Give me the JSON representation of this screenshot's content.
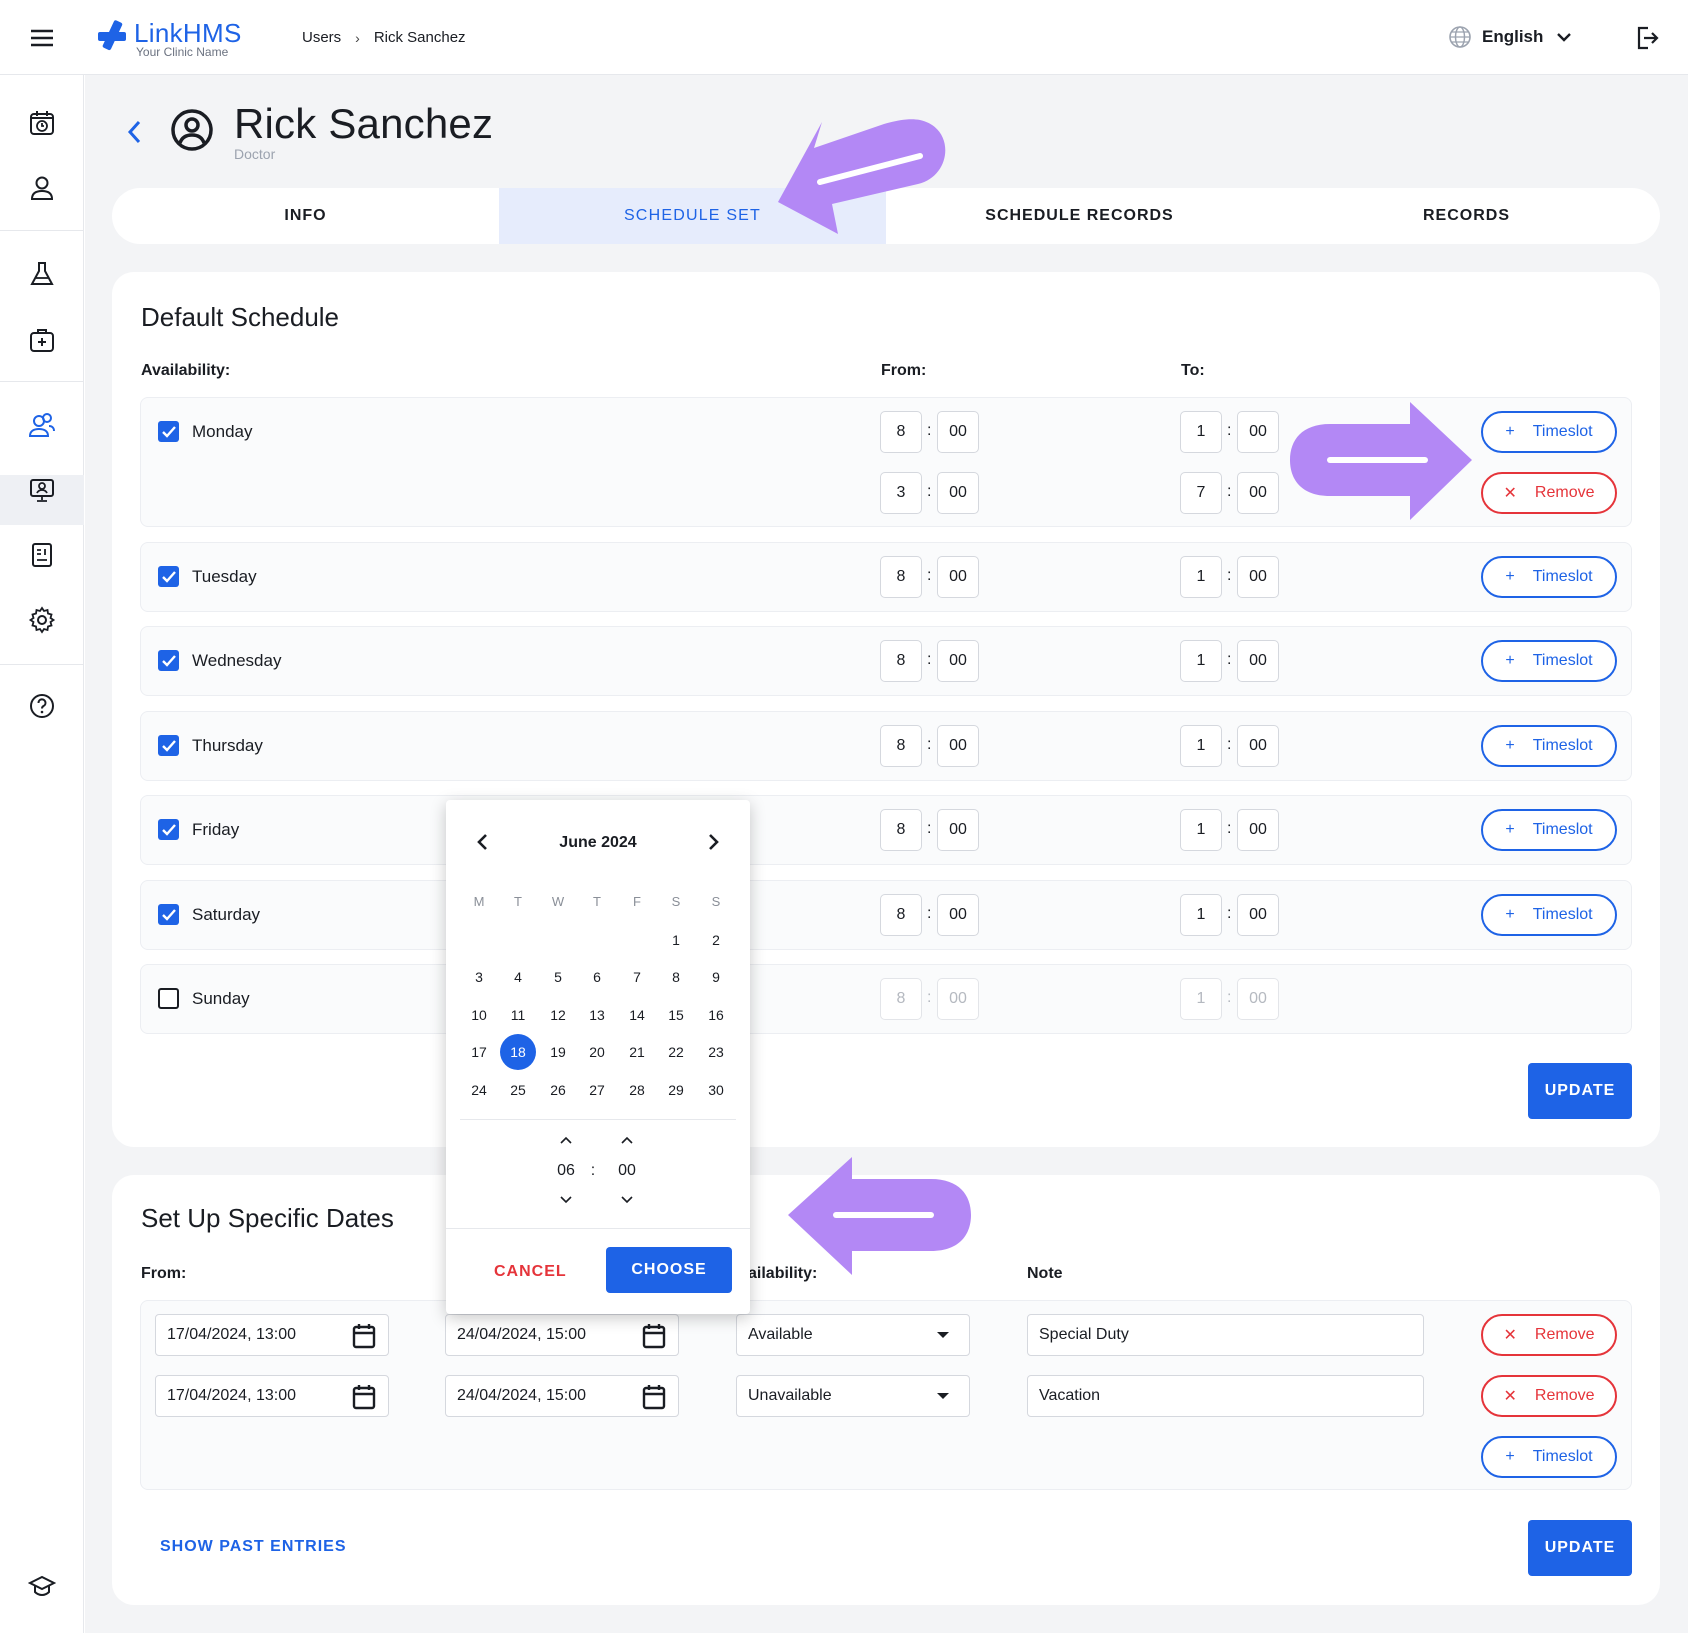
{
  "app": {
    "logo_name_link": "Link",
    "logo_name_hms": "HMS",
    "logo_sub": "Your Clinic Name",
    "brand_color": "#1e63e6"
  },
  "breadcrumb": [
    "Users",
    "Rick Sanchez"
  ],
  "language": "English",
  "sidebar_icons": [
    "calendar-clock-icon",
    "person-icon",
    "flask-icon",
    "medical-kit-icon",
    "users-icon",
    "monitor-person-icon",
    "invoice-icon",
    "gear-icon",
    "help-icon",
    "graduation-cap-icon"
  ],
  "profile": {
    "name": "Rick Sanchez",
    "role": "Doctor"
  },
  "tabs": [
    {
      "label": "INFO",
      "active": false
    },
    {
      "label": "SCHEDULE SET",
      "active": true
    },
    {
      "label": "SCHEDULE RECORDS",
      "active": false
    },
    {
      "label": "RECORDS",
      "active": false
    }
  ],
  "default_schedule": {
    "title": "Default Schedule",
    "availability_label": "Availability:",
    "from_label": "From:",
    "to_label": "To:",
    "timeslot_label": "Timeslot",
    "remove_label": "Remove",
    "update_label": "UPDATE",
    "monday": {
      "day": "Monday",
      "checked": true,
      "slots": [
        {
          "from_h": "8",
          "from_m": "00",
          "to_h": "1",
          "to_m": "00"
        },
        {
          "from_h": "3",
          "from_m": "00",
          "to_h": "7",
          "to_m": "00"
        }
      ]
    },
    "tuesday": {
      "day": "Tuesday",
      "checked": true,
      "from_h": "8",
      "from_m": "00",
      "to_h": "1",
      "to_m": "00"
    },
    "wednesday": {
      "day": "Wednesday",
      "checked": true,
      "from_h": "8",
      "from_m": "00",
      "to_h": "1",
      "to_m": "00"
    },
    "thursday": {
      "day": "Thursday",
      "checked": true,
      "from_h": "8",
      "from_m": "00",
      "to_h": "1",
      "to_m": "00"
    },
    "friday": {
      "day": "Friday",
      "checked": true,
      "from_h": "8",
      "from_m": "00",
      "to_h": "1",
      "to_m": "00"
    },
    "saturday": {
      "day": "Saturday",
      "checked": true,
      "from_h": "8",
      "from_m": "00",
      "to_h": "1",
      "to_m": "00"
    },
    "sunday": {
      "day": "Sunday",
      "checked": false,
      "from_h": "8",
      "from_m": "00",
      "to_h": "1",
      "to_m": "00"
    }
  },
  "specific_dates": {
    "title": "Set Up Specific Dates",
    "from_label": "From:",
    "availability_label": "ailability:",
    "note_label": "Note",
    "remove_label": "Remove",
    "timeslot_label": "Timeslot",
    "update_label": "UPDATE",
    "show_past_label": "SHOW PAST ENTRIES",
    "rows": [
      {
        "from": "17/04/2024, 13:00",
        "to": "24/04/2024, 15:00",
        "availability": "Available",
        "note": "Special Duty"
      },
      {
        "from": "17/04/2024, 13:00",
        "to": "24/04/2024, 15:00",
        "availability": "Unavailable",
        "note": "Vacation"
      }
    ]
  },
  "date_picker": {
    "month_label": "June 2024",
    "weekdays": [
      "M",
      "T",
      "W",
      "T",
      "F",
      "S",
      "S"
    ],
    "week1": [
      "1",
      "2"
    ],
    "week2": [
      "3",
      "4",
      "5",
      "6",
      "7",
      "8",
      "9"
    ],
    "week3": [
      "10",
      "11",
      "12",
      "13",
      "14",
      "15",
      "16"
    ],
    "week4": [
      "17",
      "18",
      "19",
      "20",
      "21",
      "22",
      "23"
    ],
    "week5": [
      "24",
      "25",
      "26",
      "27",
      "28",
      "29",
      "30"
    ],
    "selected_day": "18",
    "hour": "06",
    "minute": "00",
    "colon": ":",
    "cancel_label": "CANCEL",
    "choose_label": "CHOOSE"
  },
  "annotation_color": "#b388f5"
}
